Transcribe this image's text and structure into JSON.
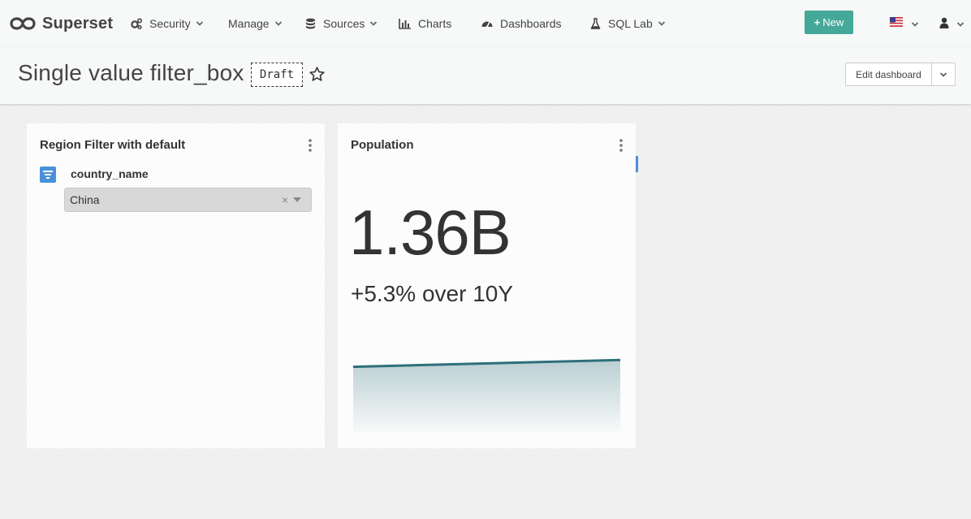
{
  "navbar": {
    "brand": "Superset",
    "menus": [
      {
        "label": "Security",
        "icon": "cogs-icon",
        "has_caret": true
      },
      {
        "label": "Manage",
        "icon": "",
        "has_caret": true
      },
      {
        "label": "Sources",
        "icon": "database-icon",
        "has_caret": true
      },
      {
        "label": "Charts",
        "icon": "bar-chart-icon",
        "has_caret": false
      },
      {
        "label": "Dashboards",
        "icon": "dashboard-icon",
        "has_caret": false
      },
      {
        "label": "SQL Lab",
        "icon": "flask-icon",
        "has_caret": true
      }
    ],
    "new_button": "New",
    "language_icon": "us-flag-icon",
    "user_icon": "user-icon"
  },
  "dashboard": {
    "title": "Single value filter_box",
    "status_badge": "Draft",
    "edit_button": "Edit dashboard"
  },
  "filter_card": {
    "title": "Region Filter with default",
    "field_name": "country_name",
    "selected_value": "China",
    "clear_symbol": "×"
  },
  "population_card": {
    "title": "Population",
    "big_number": "1.36B",
    "subheader": "+5.3% over 10Y",
    "trend_start": 1.29,
    "trend_end": 1.36
  },
  "colors": {
    "new_button": "#45a899",
    "accent_blue": "#4a90d9",
    "trend_line": "#2e6f7a"
  }
}
